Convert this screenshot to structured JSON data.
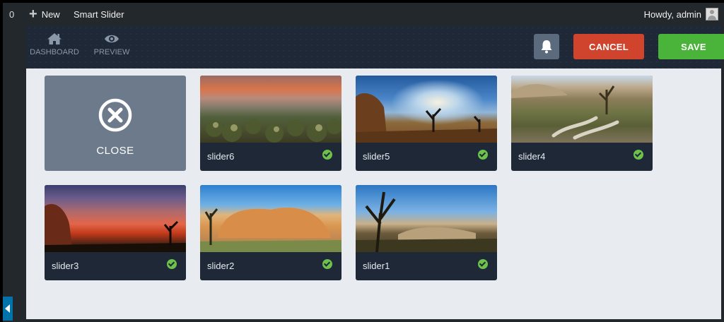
{
  "adminbar": {
    "count": "0",
    "new_label": "New",
    "app_name": "Smart Slider",
    "greeting": "Howdy, admin"
  },
  "topbar": {
    "dashboard_label": "DASHBOARD",
    "preview_label": "PREVIEW",
    "cancel_label": "CANCEL",
    "save_label": "SAVE"
  },
  "close_card": {
    "label": "CLOSE"
  },
  "sliders": [
    {
      "name": "slider6",
      "published": true
    },
    {
      "name": "slider5",
      "published": true
    },
    {
      "name": "slider4",
      "published": true
    },
    {
      "name": "slider3",
      "published": true
    },
    {
      "name": "slider2",
      "published": true
    },
    {
      "name": "slider1",
      "published": true
    }
  ],
  "colors": {
    "topbar_bg": "#1e2837",
    "cancel": "#d0442e",
    "save": "#4ab43a",
    "check": "#6cc24a",
    "content_bg": "#e8ecf0"
  },
  "icons": [
    "plus-icon",
    "avatar-icon",
    "home-icon",
    "eye-icon",
    "bell-icon",
    "close-circle-icon",
    "check-icon"
  ]
}
